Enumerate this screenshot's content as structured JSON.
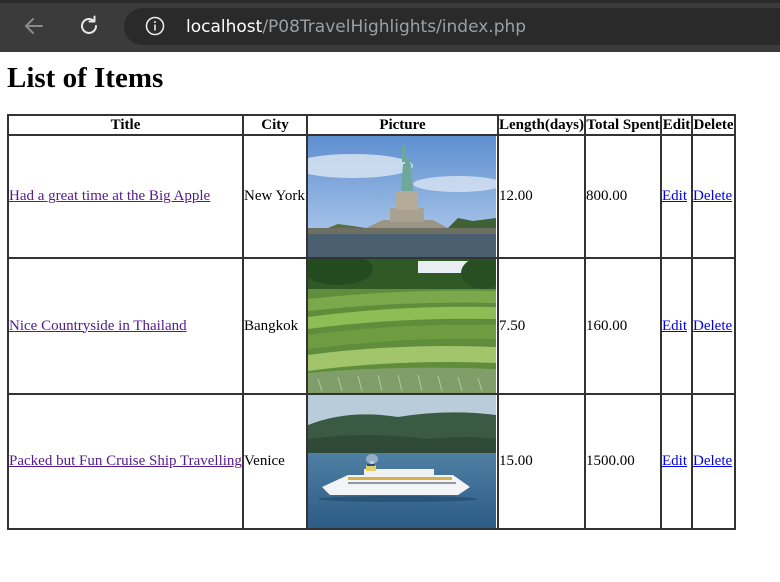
{
  "browser": {
    "url_host": "localhost",
    "url_path": "/P08TravelHighlights/index.php"
  },
  "page": {
    "title": "List of Items"
  },
  "table": {
    "headers": [
      "Title",
      "City",
      "Picture",
      "Length(days)",
      "Total Spent",
      "Edit",
      "Delete"
    ],
    "rows": [
      {
        "title": "Had a great time at the Big Apple",
        "city": "New York",
        "picture": "statue-of-liberty-photo",
        "length": "12.00",
        "spent": "800.00",
        "edit": "Edit",
        "delete": "Delete"
      },
      {
        "title": "Nice Countryside in Thailand",
        "city": "Bangkok",
        "picture": "rice-terraces-photo",
        "length": "7.50",
        "spent": "160.00",
        "edit": "Edit",
        "delete": "Delete"
      },
      {
        "title": "Packed but Fun Cruise Ship Travelling",
        "city": "Venice",
        "picture": "cruise-ship-photo",
        "length": "15.00",
        "spent": "1500.00",
        "edit": "Edit",
        "delete": "Delete"
      }
    ]
  },
  "colors": {
    "visited_link": "#551a8b",
    "link": "#0000ee",
    "chrome_bg": "#3b3b3b",
    "omnibox_bg": "#2a2a2a"
  }
}
